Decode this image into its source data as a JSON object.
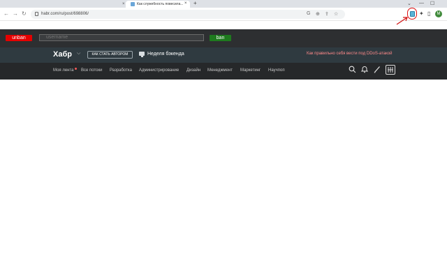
{
  "browser": {
    "tab_inactive_close": "×",
    "tab_active_title": "Как служебность повесила...",
    "tab_active_close": "×",
    "new_tab": "+",
    "window_controls": [
      "⌄",
      "—",
      "☐"
    ],
    "url": "habr.com/ru/post/698806/",
    "avatar_letter": "M"
  },
  "extension": {
    "unban_label": "unban",
    "username_placeholder": "username",
    "ban_label": "ban"
  },
  "habr": {
    "logo": "Хабр",
    "cta_label": "КАК СТАТЬ АВТОРОМ",
    "week_label": "Неделя бэкенда",
    "promo_text": "Как правильно себя вести под DDoS-атакой",
    "nav_items": [
      "Моя лента",
      "Все потоки",
      "Разработка",
      "Администрирование",
      "Дизайн",
      "Менеджмент",
      "Маркетинг",
      "Научпоп"
    ]
  },
  "colors": {
    "unban": "#e60000",
    "ban": "#1e7a1e",
    "promo": "#ff8a8a",
    "annotation": "#d11111"
  }
}
